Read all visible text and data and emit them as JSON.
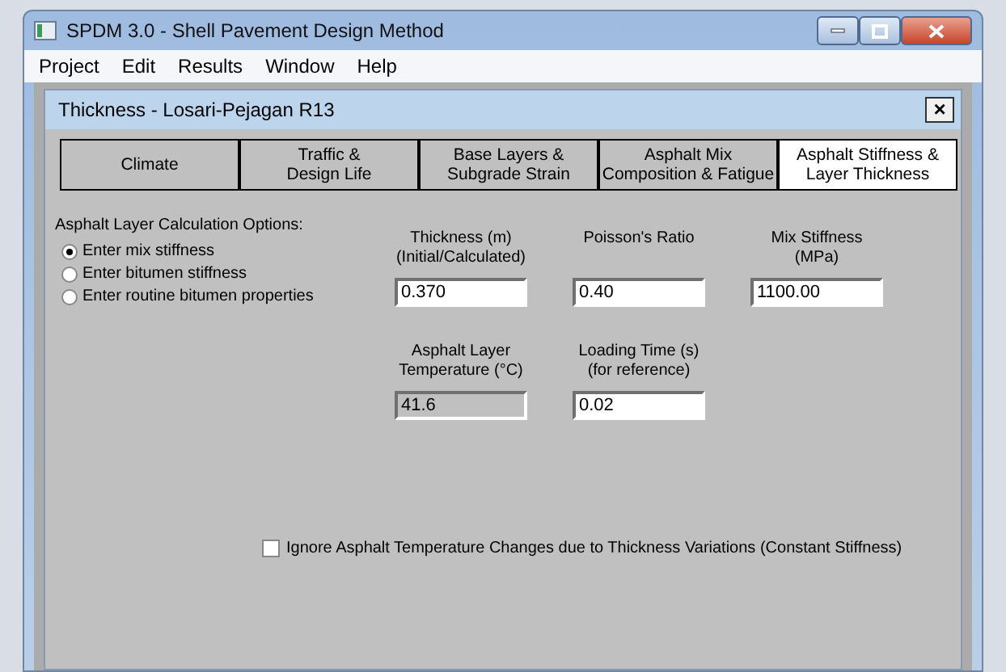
{
  "window": {
    "title": "SPDM 3.0 - Shell Pavement Design Method"
  },
  "menu": [
    "Project",
    "Edit",
    "Results",
    "Window",
    "Help"
  ],
  "child_window": {
    "title": "Thickness - Losari-Pejagan R13",
    "close": "×"
  },
  "tabs": [
    {
      "label": "Climate",
      "selected": false
    },
    {
      "label": "Traffic &\nDesign Life",
      "selected": false
    },
    {
      "label": "Base Layers &\nSubgrade Strain",
      "selected": false
    },
    {
      "label": "Asphalt Mix\nComposition & Fatigue",
      "selected": false
    },
    {
      "label": "Asphalt Stiffness &\nLayer Thickness",
      "selected": true
    }
  ],
  "options": {
    "label": "Asphalt Layer Calculation Options:",
    "radios": [
      {
        "label": "Enter mix stiffness",
        "selected": true
      },
      {
        "label": "Enter bitumen stiffness",
        "selected": false
      },
      {
        "label": "Enter routine bitumen properties",
        "selected": false
      }
    ]
  },
  "field_rows": [
    [
      {
        "label": "Thickness (m)\n(Initial/Calculated)",
        "value": "0.370",
        "disabled": false
      },
      {
        "label": "Poisson's Ratio",
        "value": "0.40",
        "disabled": false
      },
      {
        "label": "Mix Stiffness\n(MPa)",
        "value": "1100.00",
        "disabled": false
      }
    ],
    [
      {
        "label": "Asphalt Layer\nTemperature (°C)",
        "value": "41.6",
        "disabled": true
      },
      {
        "label": "Loading Time (s)\n(for reference)",
        "value": "0.02",
        "disabled": false
      }
    ]
  ],
  "checkbox": {
    "label": "Ignore Asphalt Temperature Changes due to Thickness Variations (Constant Stiffness)",
    "checked": false
  }
}
